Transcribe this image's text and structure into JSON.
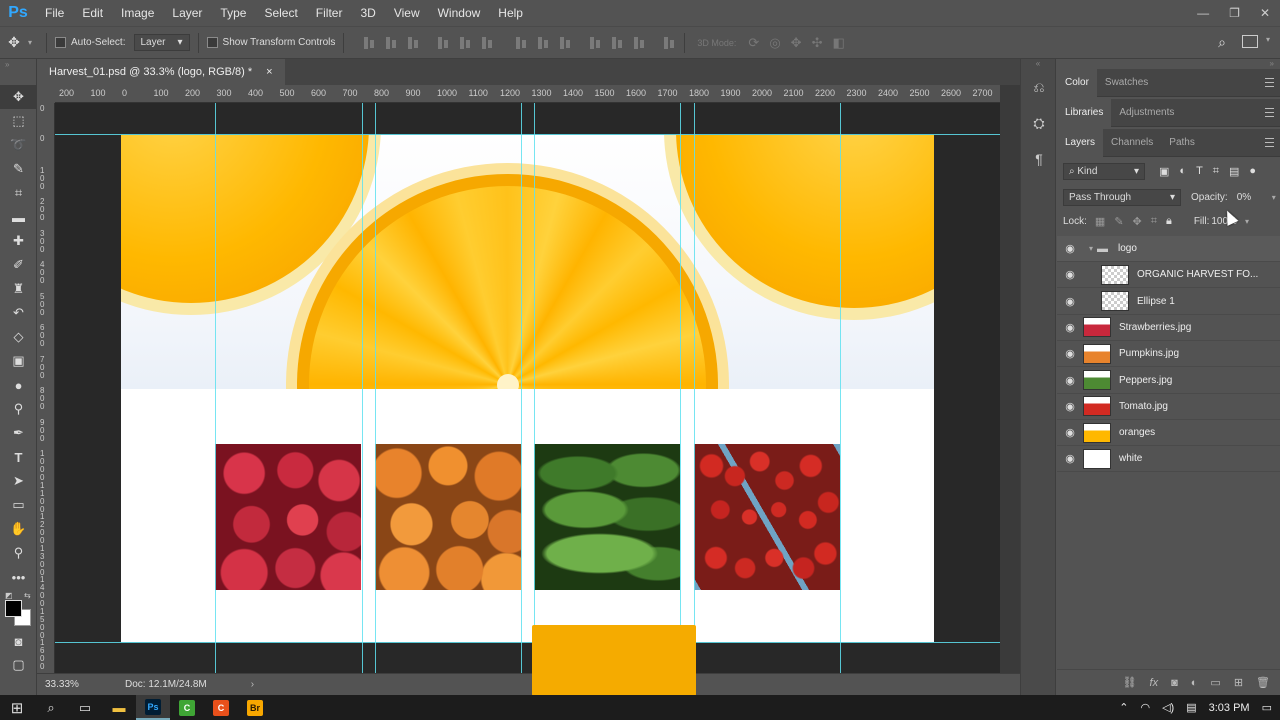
{
  "app": {
    "logo": "Ps",
    "brand_color": "#31a8ff"
  },
  "menu": [
    "File",
    "Edit",
    "Image",
    "Layer",
    "Type",
    "Select",
    "Filter",
    "3D",
    "View",
    "Window",
    "Help"
  ],
  "window_controls": {
    "minimize": "—",
    "restore": "❐",
    "close": "✕"
  },
  "options": {
    "auto_select_label": "Auto-Select:",
    "auto_select_target": "Layer",
    "show_transform_label": "Show Transform Controls",
    "mode_3d_label": "3D Mode:"
  },
  "document": {
    "tab_title": "Harvest_01.psd @ 33.3% (logo, RGB/8) *",
    "close_glyph": "×"
  },
  "ruler_top_labels": [
    "200",
    "100",
    "0",
    "100",
    "200",
    "300",
    "400",
    "500",
    "600",
    "700",
    "800",
    "900",
    "1000",
    "1100",
    "1200",
    "1300",
    "1400",
    "1500",
    "1600",
    "1700",
    "1800",
    "1900",
    "2000",
    "2100",
    "2200",
    "2300",
    "2400",
    "2500",
    "2600",
    "2700"
  ],
  "ruler_left_labels": [
    "0",
    "0",
    "1 0 0",
    "2 0 0",
    "3 0 0",
    "4 0 0",
    "5 0 0",
    "6 0 0",
    "7 0 0",
    "8 0 0",
    "9 0 0",
    "1 0 0 0",
    "1 1 0 0",
    "1 2 0 0",
    "1 3 0 0",
    "1 4 0 0",
    "1 5 0 0",
    "1 6 0 0"
  ],
  "status": {
    "zoom": "33.33%",
    "doc_size": "Doc: 12.1M/24.8M",
    "arrow": "›"
  },
  "panels": {
    "group1_tabs": [
      "Color",
      "Swatches"
    ],
    "group2_tabs": [
      "Libraries",
      "Adjustments"
    ],
    "group3_tabs": [
      "Layers",
      "Channels",
      "Paths"
    ],
    "filter_kind": "Kind",
    "blend_mode": "Pass Through",
    "opacity_label": "Opacity:",
    "opacity_value": "0%",
    "lock_label": "Lock:",
    "fill_label": "Fill:",
    "fill_value": "100%"
  },
  "layers": [
    {
      "name": "logo",
      "type": "group",
      "selected": true
    },
    {
      "name": "ORGANIC HARVEST FO...",
      "type": "smart",
      "indent": true
    },
    {
      "name": "Ellipse 1",
      "type": "smart",
      "indent": true
    },
    {
      "name": "Strawberries.jpg",
      "type": "image"
    },
    {
      "name": "Pumpkins.jpg",
      "type": "image"
    },
    {
      "name": "Peppers.jpg",
      "type": "image"
    },
    {
      "name": "Tomato.jpg",
      "type": "image"
    },
    {
      "name": "oranges",
      "type": "image"
    },
    {
      "name": "white",
      "type": "fill"
    }
  ],
  "taskbar": {
    "clock": "3:03 PM",
    "apps": [
      {
        "label": "Ps",
        "color": "#31a8ff",
        "bg": "#001d34"
      },
      {
        "label": "C",
        "color": "#ffffff",
        "bg": "#3fa535"
      },
      {
        "label": "C",
        "color": "#ffffff",
        "bg": "#e8501b"
      },
      {
        "label": "Br",
        "color": "#2b1a00",
        "bg": "#f7a700"
      }
    ]
  },
  "colors": {
    "guide": "#5ee0f0",
    "orange_accent": "#f5ab00",
    "panel_bg": "#535353",
    "canvas_bg": "#282828"
  },
  "icons": {
    "move": "move-icon",
    "marquee": "marquee-icon",
    "lasso": "lasso-icon",
    "quick-select": "quick-select-icon",
    "crop": "crop-icon",
    "eyedropper": "eyedropper-icon",
    "healing": "healing-brush-icon",
    "brush": "brush-icon",
    "stamp": "clone-stamp-icon",
    "history": "history-brush-icon",
    "eraser": "eraser-icon",
    "gradient": "gradient-icon",
    "blur": "blur-icon",
    "dodge": "dodge-icon",
    "pen": "pen-icon",
    "type": "type-icon",
    "path-select": "path-selection-icon",
    "shape": "rectangle-icon",
    "hand": "hand-icon",
    "zoom": "zoom-icon",
    "more": "more-tools-icon"
  }
}
